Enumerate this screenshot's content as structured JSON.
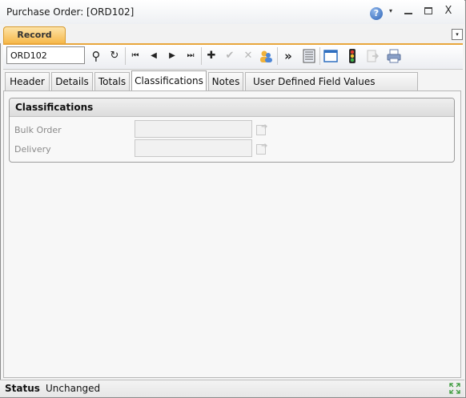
{
  "window": {
    "title": "Purchase Order: [ORD102]",
    "help_glyph": "?",
    "help_caret": "▾",
    "close_glyph": "X"
  },
  "ribbon": {
    "record_tab_label": "Record",
    "collapse_glyph": "▾"
  },
  "toolbar": {
    "record_value": "ORD102",
    "icons": {
      "search": "⚲",
      "refresh": "↻",
      "first": "⏮",
      "prev": "◀",
      "next": "▶",
      "last": "⏭",
      "add": "✚",
      "save": "✔",
      "cancel": "✕",
      "more": "»"
    }
  },
  "tabs": [
    {
      "label": "Header"
    },
    {
      "label": "Details"
    },
    {
      "label": "Totals"
    },
    {
      "label": "Classifications"
    },
    {
      "label": "Notes"
    },
    {
      "label": "User Defined Field Values"
    }
  ],
  "classifications": {
    "title": "Classifications",
    "fields": [
      {
        "label": "Bulk Order",
        "value": ""
      },
      {
        "label": "Delivery",
        "value": ""
      }
    ]
  },
  "status": {
    "label": "Status",
    "value": "Unchanged"
  },
  "colors": {
    "accent": "#f6b84a",
    "accent_border": "#e8a63c",
    "resize": "#3a9a3a"
  }
}
